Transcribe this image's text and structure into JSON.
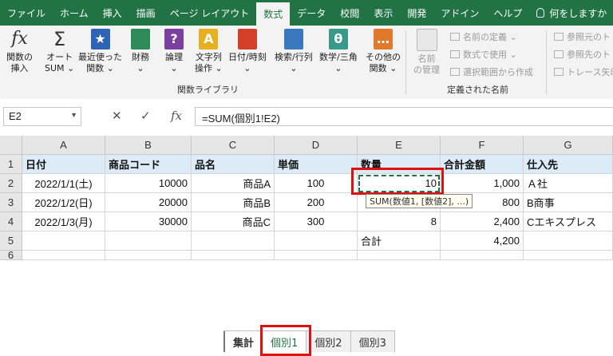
{
  "ribbon": {
    "tabs": [
      {
        "label": "ファイル",
        "active": false
      },
      {
        "label": "ホーム",
        "active": false
      },
      {
        "label": "挿入",
        "active": false
      },
      {
        "label": "描画",
        "active": false
      },
      {
        "label": "ページ レイアウト",
        "active": false
      },
      {
        "label": "数式",
        "active": true
      },
      {
        "label": "データ",
        "active": false
      },
      {
        "label": "校閲",
        "active": false
      },
      {
        "label": "表示",
        "active": false
      },
      {
        "label": "開発",
        "active": false
      },
      {
        "label": "アドイン",
        "active": false
      },
      {
        "label": "ヘルプ",
        "active": false
      }
    ],
    "tell_me": "何をしますか",
    "function_library": {
      "group_label": "関数ライブラリ",
      "insert_function": {
        "line1": "関数の",
        "line2": "挿入",
        "icon_text": "fx"
      },
      "autosum": {
        "line1": "オート",
        "line2": "SUM ⌄",
        "icon_text": "Σ"
      },
      "recent": {
        "line1": "最近使った",
        "line2": "関数 ⌄",
        "icon_text": "★"
      },
      "financial": {
        "line1": "財務",
        "line2": "⌄"
      },
      "logical": {
        "line1": "論理",
        "line2": "⌄",
        "icon_text": "?"
      },
      "text": {
        "line1": "文字列",
        "line2": "操作 ⌄",
        "icon_text": "A"
      },
      "datetime": {
        "line1": "日付/時刻",
        "line2": "⌄"
      },
      "lookup": {
        "line1": "検索/行列",
        "line2": "⌄"
      },
      "math": {
        "line1": "数学/三角",
        "line2": "⌄",
        "icon_text": "θ"
      },
      "more": {
        "line1": "その他の",
        "line2": "関数 ⌄",
        "icon_text": "…"
      }
    },
    "defined_names": {
      "group_label": "定義された名前",
      "name_manager": {
        "line1": "名前",
        "line2": "の管理"
      },
      "define_name": "名前の定義 ⌄",
      "use_in_formula": "数式で使用 ⌄",
      "create_from_selection": "選択範囲から作成"
    },
    "auditing": {
      "trace_precedents": "参照元のト",
      "trace_dependents": "参照先のト",
      "remove_arrows": "トレース矢印"
    },
    "colors": {
      "accent": "#217346"
    }
  },
  "formula_bar": {
    "name_box": "E2",
    "cancel_icon": "✕",
    "enter_icon": "✓",
    "fx_label": "fx",
    "formula": "=SUM(個別1!E2)"
  },
  "grid": {
    "columns": [
      "A",
      "B",
      "C",
      "D",
      "E",
      "F",
      "G"
    ],
    "row_numbers": [
      "1",
      "2",
      "3",
      "4",
      "5",
      "6"
    ],
    "header": [
      "日付",
      "商品コード",
      "品名",
      "単価",
      "数量",
      "合計金額",
      "仕入先"
    ],
    "rows": [
      [
        "2022/1/1(土)",
        "10000",
        "商品A",
        "100",
        "10",
        "1,000",
        "Ａ社"
      ],
      [
        "2022/1/2(日)",
        "20000",
        "商品B",
        "200",
        "",
        "800",
        "B商事"
      ],
      [
        "2022/1/3(月)",
        "30000",
        "商品C",
        "300",
        "8",
        "2,400",
        "Cエキスプレス"
      ],
      [
        "",
        "",
        "",
        "",
        "合計",
        "4,200",
        ""
      ]
    ],
    "tooltip": "SUM(数値1, [数値2], ...)"
  },
  "sheet_tabs": [
    {
      "label": "集計",
      "active": false
    },
    {
      "label": "個別1",
      "active": true
    },
    {
      "label": "個別2",
      "active": false
    },
    {
      "label": "個別3",
      "active": false
    }
  ]
}
